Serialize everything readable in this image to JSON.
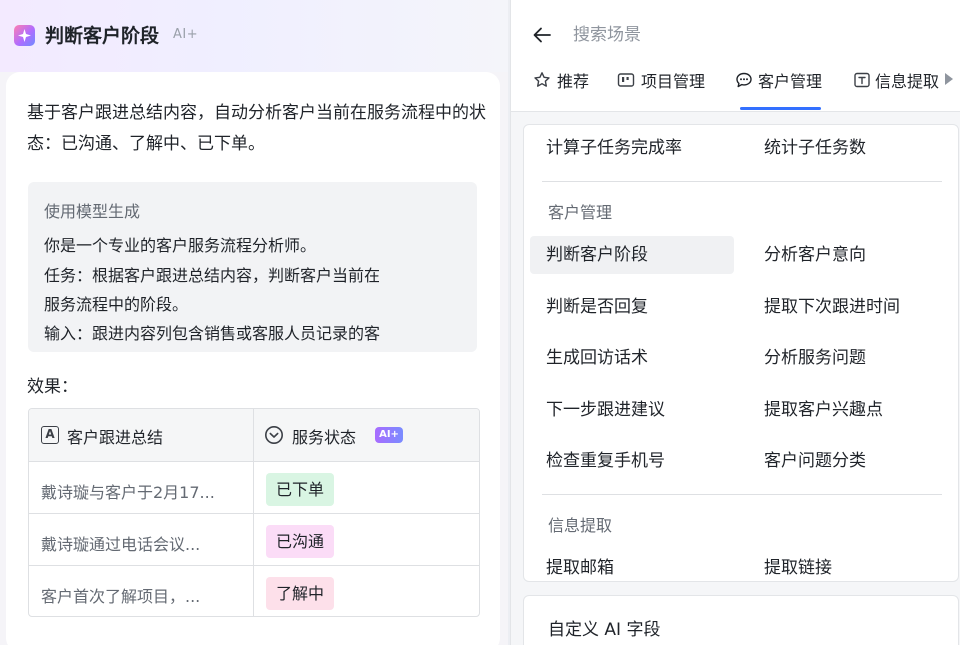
{
  "left": {
    "title": "判断客户阶段",
    "ai_tag": "AI+",
    "description": "基于客户跟进总结内容，自动分析客户当前在服务流程中的状态：已沟通、了解中、已下单。",
    "prompt_title": "使用模型生成",
    "prompt_lines": [
      "你是一个专业的客户服务流程分析师。",
      "任务：根据客户跟进总结内容，判断客户当前在",
      "服务流程中的阶段。",
      "输入：跟进内容列包含销售或客服人员记录的客"
    ],
    "effect_label": "效果：",
    "table": {
      "col1_header": "客户跟进总结",
      "col2_header": "服务状态",
      "col2_ai": "AI+",
      "col1_icon_letter": "A",
      "rows": [
        {
          "summary": "戴诗璇与客户于2月17...",
          "status": "已下单",
          "status_color": "#d9f5e3"
        },
        {
          "summary": "戴诗璇通过电话会议...",
          "status": "已沟通",
          "status_color": "#fbdcf7"
        },
        {
          "summary": "客户首次了解项目，...",
          "status": "了解中",
          "status_color": "#fde0ea"
        }
      ]
    }
  },
  "right": {
    "search_placeholder": "搜索场景",
    "tabs": [
      {
        "label": "推荐",
        "icon": "star-icon"
      },
      {
        "label": "项目管理",
        "icon": "board-icon"
      },
      {
        "label": "客户管理",
        "icon": "chat-icon",
        "active": true
      },
      {
        "label": "信息提取",
        "icon": "text-box-icon"
      }
    ],
    "menu_top_row": [
      "计算子任务完成率",
      "统计子任务数"
    ],
    "section_customer": "客户管理",
    "customer_items": [
      [
        "判断客户阶段",
        "分析客户意向"
      ],
      [
        "判断是否回复",
        "提取下次跟进时间"
      ],
      [
        "生成回访话术",
        "分析服务问题"
      ],
      [
        "下一步跟进建议",
        "提取客户兴趣点"
      ],
      [
        "检查重复手机号",
        "客户问题分类"
      ]
    ],
    "section_info": "信息提取",
    "info_items": [
      "提取邮箱",
      "提取链接"
    ],
    "custom_field": "自定义 AI 字段",
    "accent_color": "#3370ff"
  }
}
